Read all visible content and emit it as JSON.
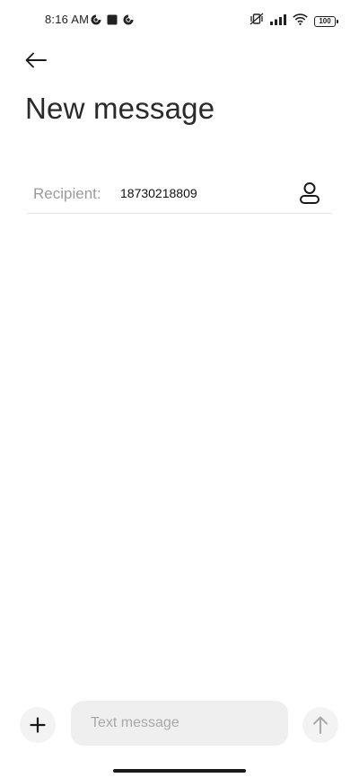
{
  "status_bar": {
    "time": "8:16 AM",
    "left_icons": [
      "chrome-icon",
      "app-square-icon",
      "chrome-icon"
    ],
    "right_icons": [
      "vibrate-off-icon",
      "cellular-signal-icon",
      "wifi-icon"
    ],
    "battery_level": "100"
  },
  "header": {
    "title": "New message"
  },
  "recipient": {
    "label": "Recipient:",
    "value": "18730218809",
    "contact_icon": "contact-person-icon"
  },
  "composer": {
    "placeholder": "Text message",
    "add_icon": "plus-icon",
    "send_icon": "arrow-up-icon"
  },
  "colors": {
    "background": "#ffffff",
    "title_text": "#2a2a2a",
    "label_text": "#9b9b9b",
    "composer_bg": "#efefef",
    "divider": "#e2e2e2"
  }
}
